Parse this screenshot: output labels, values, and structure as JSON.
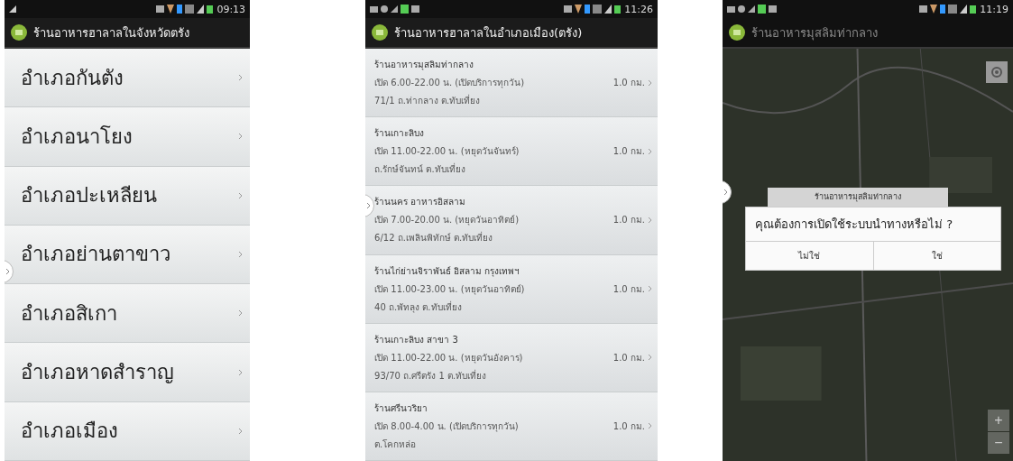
{
  "screens": [
    {
      "kind": "district_list",
      "status_bar": {
        "time": "09:13"
      },
      "title": "ร้านอาหารฮาลาลในจังหวัดตรัง",
      "items": [
        {
          "label": "อำเภอกันตัง"
        },
        {
          "label": "อำเภอนาโยง"
        },
        {
          "label": "อำเภอปะเหลียน"
        },
        {
          "label": "อำเภอย่านตาขาว"
        },
        {
          "label": "อำเภอสิเกา"
        },
        {
          "label": "อำเภอหาดสำราญ"
        },
        {
          "label": "อำเภอเมือง"
        }
      ]
    },
    {
      "kind": "restaurant_list",
      "status_bar": {
        "time": "11:26"
      },
      "title": "ร้านอาหารฮาลาลในอำเภอเมือง(ตรัง)",
      "items": [
        {
          "name": "ร้านอาหารมุสลิมท่ากลาง",
          "hours": "เปิด 6.00-22.00 น. (เปิดบริการทุกวัน)",
          "address": "71/1 ถ.ท่ากลาง ต.ทับเที่ยง",
          "distance": "1.0 กม."
        },
        {
          "name": "ร้านเกาะลิบง",
          "hours": "เปิด 11.00-22.00 น. (หยุดวันจันทร์)",
          "address": "ถ.รักษ์จันทน์ ต.ทับเที่ยง",
          "distance": "1.0 กม."
        },
        {
          "name": "ร้านนคร อาหารอิสลาม",
          "hours": "เปิด 7.00-20.00 น. (หยุดวันอาทิตย์)",
          "address": "6/12 ถ.เพลินพิทักษ์ ต.ทับเที่ยง",
          "distance": "1.0 กม."
        },
        {
          "name": "ร้านไก่ย่านจิราพันธ์ อิสลาม กรุงเทพฯ",
          "hours": "เปิด 11.00-23.00 น. (หยุดวันอาทิตย์)",
          "address": "40 ถ.พัทลุง ต.ทับเที่ยง",
          "distance": "1.0 กม."
        },
        {
          "name": "ร้านเกาะลิบง สาขา 3",
          "hours": "เปิด 11.00-22.00 น. (หยุดวันอังคาร)",
          "address": "93/70 ถ.ศรีตรัง 1 ต.ทับเที่ยง",
          "distance": "1.0 กม."
        },
        {
          "name": "ร้านศรีนวริยา",
          "hours": "เปิด 8.00-4.00 น. (เปิดบริการทุกวัน)",
          "address": "ต.โคกหล่อ",
          "distance": "1.0 กม."
        }
      ]
    },
    {
      "kind": "map",
      "status_bar": {
        "time": "11:19"
      },
      "title": "ร้านอาหารมุสลิมท่ากลาง",
      "marker_label": "ร้านอาหารมุสลิมท่ากลาง",
      "dialog": {
        "message": "คุณต้องการเปิดใช้ระบบนำทางหรือไม่ ?",
        "buttons": [
          "ไม่ใช่",
          "ใช่"
        ]
      },
      "zoom_in": "+",
      "zoom_out": "−"
    }
  ]
}
